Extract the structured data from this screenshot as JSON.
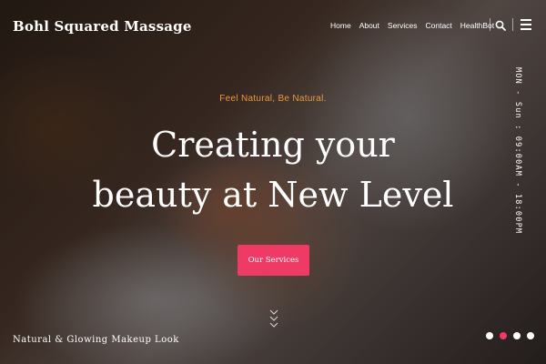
{
  "header": {
    "brand": "Bohl Squared Massage",
    "nav": [
      "Home",
      "About",
      "Services",
      "Contact",
      "HealthBot"
    ],
    "search_icon": "search-icon",
    "menu_icon": "hamburger-menu-icon"
  },
  "hero": {
    "tagline": "Feel Natural, Be Natural.",
    "headline_line1": "Creating your",
    "headline_line2": "beauty at New Level",
    "cta_label": "Our Services",
    "caption": "Natural & Glowing Makeup Look",
    "hours": "MON - Sun : 09:00AM - 18:00PM"
  },
  "slider": {
    "slide_count": 4,
    "active_index": 1
  },
  "colors": {
    "accent": "#ee3a64",
    "tagline": "#e89a3c",
    "text": "#ffffff"
  }
}
